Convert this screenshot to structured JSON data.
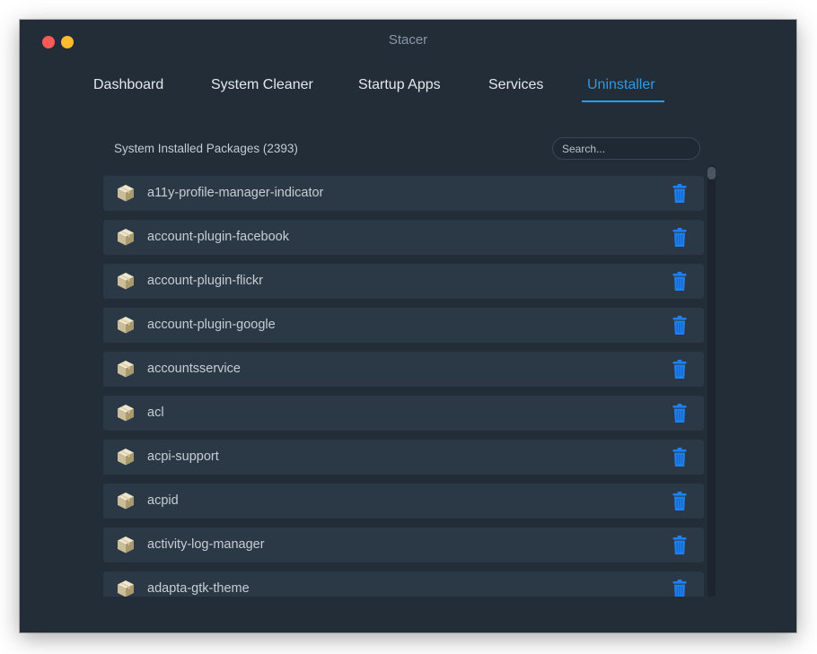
{
  "window": {
    "title": "Stacer"
  },
  "tabs": [
    {
      "label": "Dashboard",
      "active": false
    },
    {
      "label": "System Cleaner",
      "active": false
    },
    {
      "label": "Startup Apps",
      "active": false
    },
    {
      "label": "Services",
      "active": false
    },
    {
      "label": "Uninstaller",
      "active": true
    }
  ],
  "uninstaller": {
    "header": "System Installed Packages (2393)",
    "search_placeholder": "Search...",
    "packages": [
      {
        "name": "a11y-profile-manager-indicator"
      },
      {
        "name": "account-plugin-facebook"
      },
      {
        "name": "account-plugin-flickr"
      },
      {
        "name": "account-plugin-google"
      },
      {
        "name": "accountsservice"
      },
      {
        "name": "acl"
      },
      {
        "name": "acpi-support"
      },
      {
        "name": "acpid"
      },
      {
        "name": "activity-log-manager"
      },
      {
        "name": "adapta-gtk-theme"
      }
    ]
  },
  "icons": {
    "package": "package-box-icon",
    "uninstall": "trash-icon"
  },
  "colors": {
    "window_bg": "#222d38",
    "row_bg": "#2b3846",
    "accent": "#2d9ae6",
    "trash": "#1f80f0",
    "close": "#fc5a57",
    "minimize": "#fdbb2d"
  }
}
